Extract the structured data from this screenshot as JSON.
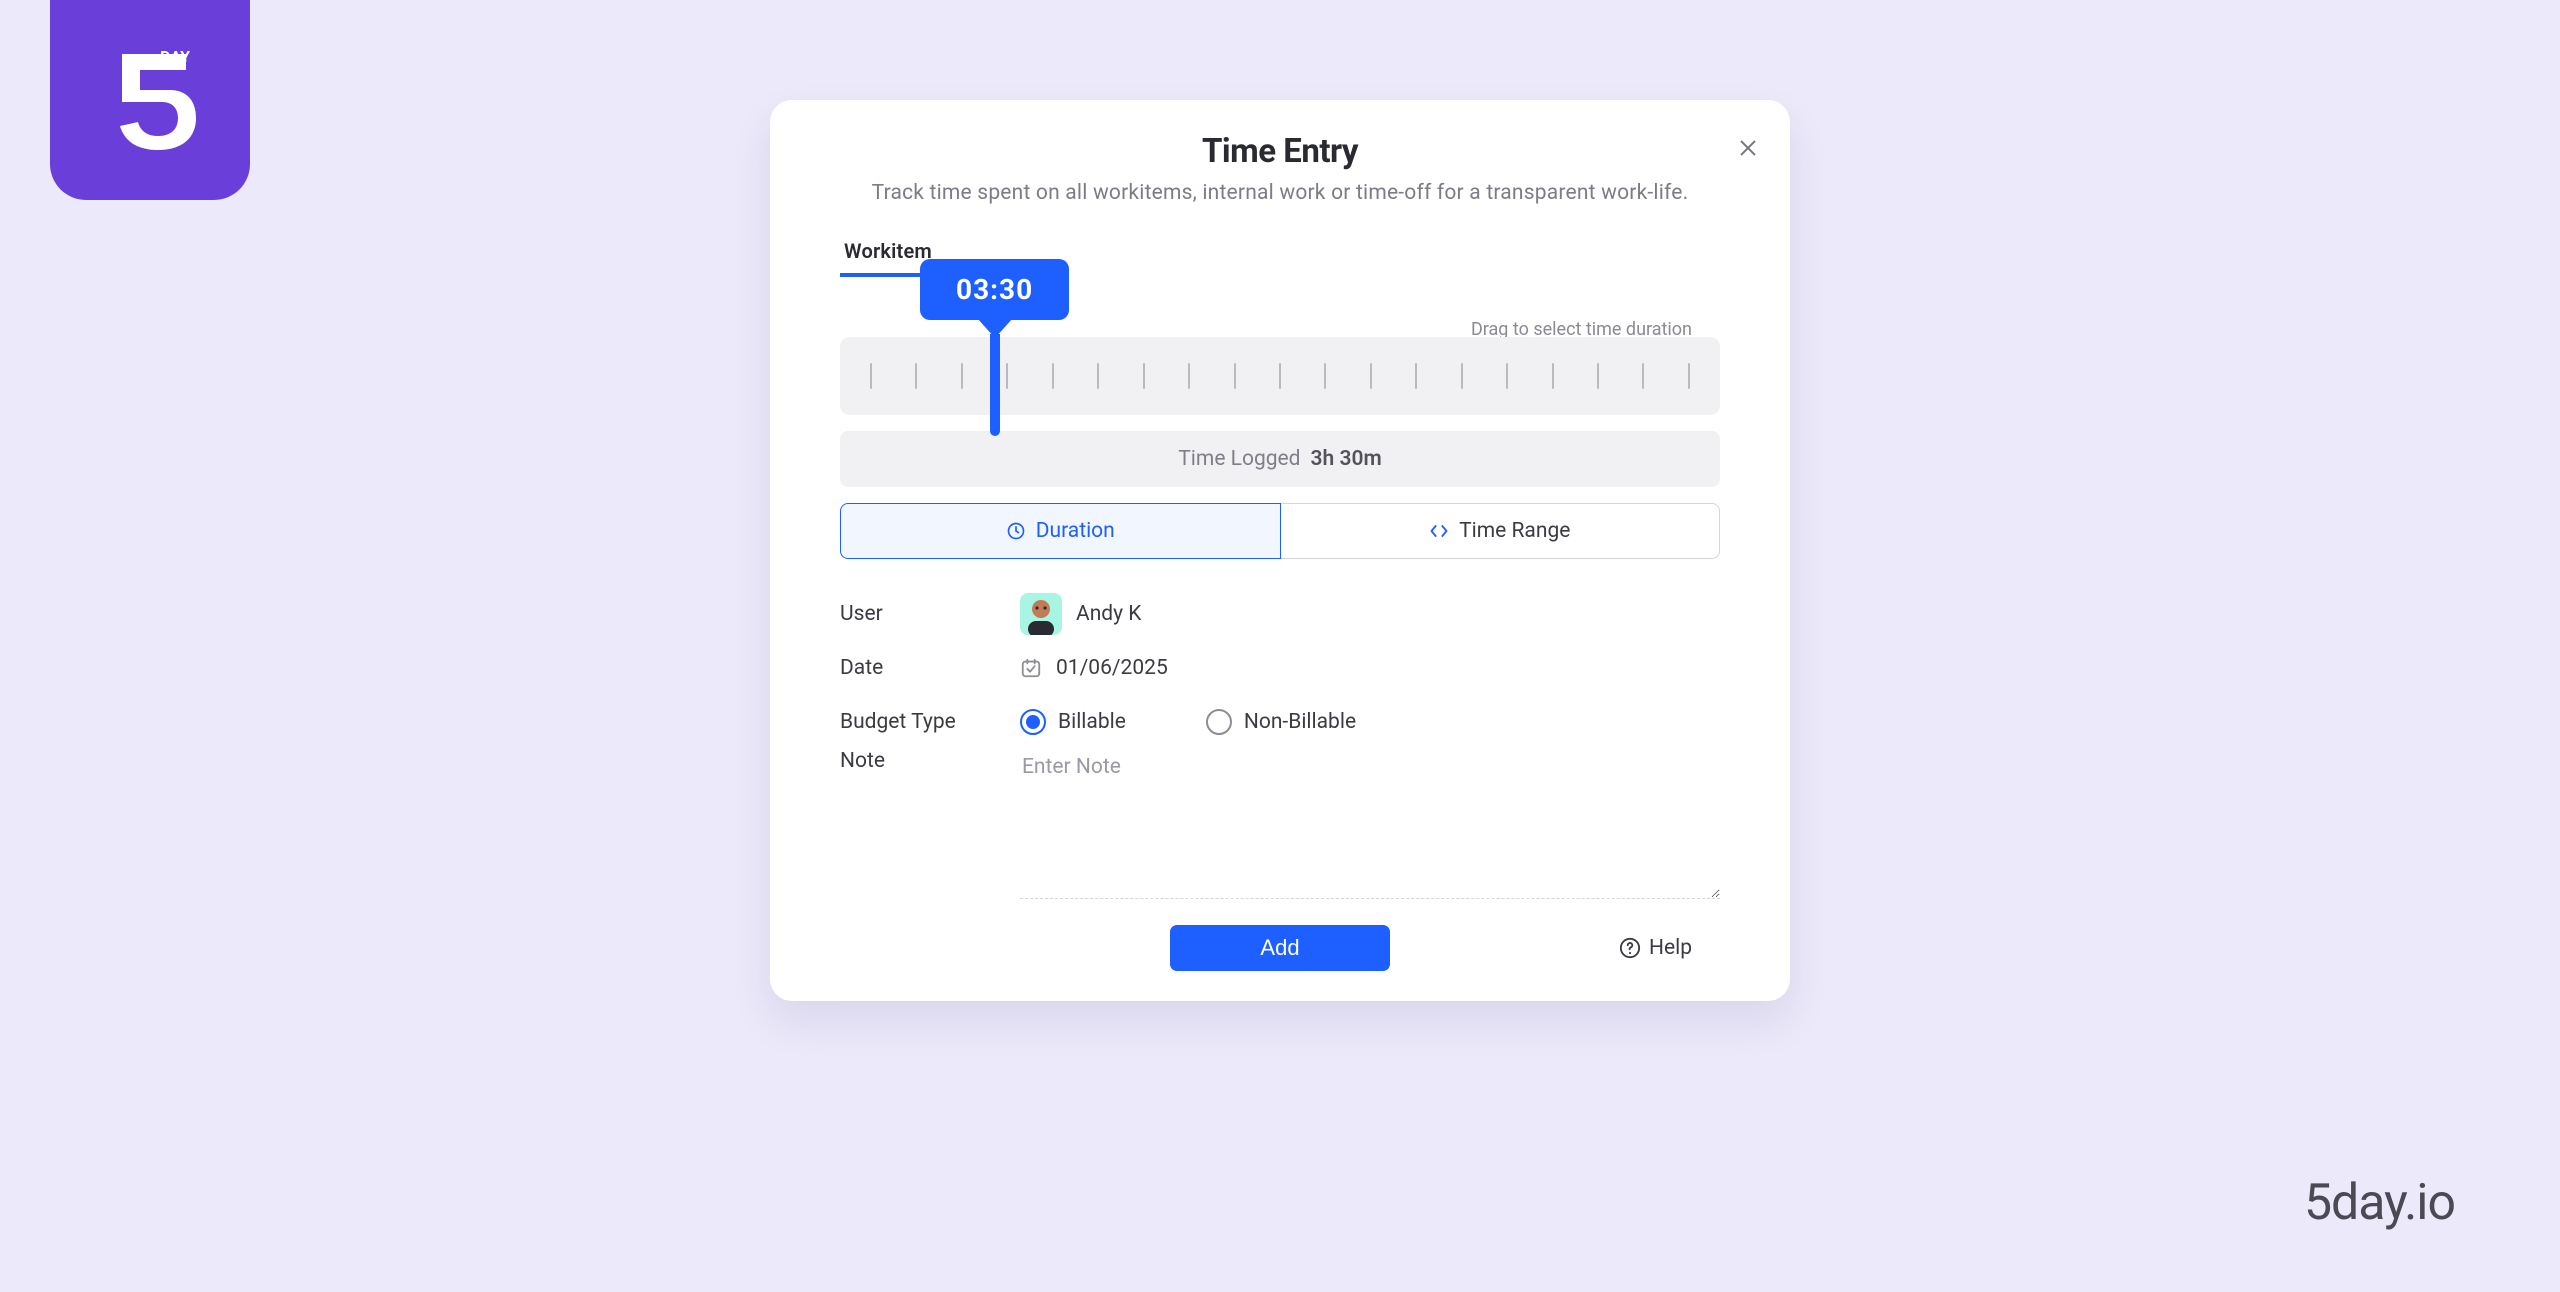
{
  "brand": {
    "name": "5day.io",
    "logo_text": "DAY"
  },
  "modal": {
    "title": "Time Entry",
    "subtitle": "Track time spent on all workitems, internal work or time-off for a transparent work-life.",
    "close_icon": "close-icon",
    "tabs": [
      {
        "label": "Workitem",
        "active": true
      }
    ],
    "slider": {
      "value_display": "03:30",
      "hint": "Drag to select time duration",
      "tick_count": 19
    },
    "time_logged": {
      "label": "Time Logged",
      "value": "3h 30m"
    },
    "mode_toggle": {
      "duration_label": "Duration",
      "time_range_label": "Time Range",
      "active": "duration"
    },
    "fields": {
      "user": {
        "label": "User",
        "name": "Andy K"
      },
      "date": {
        "label": "Date",
        "value": "01/06/2025"
      },
      "budget": {
        "label": "Budget Type",
        "options": {
          "billable": "Billable",
          "non_billable": "Non-Billable"
        },
        "selected": "billable"
      },
      "note": {
        "label": "Note",
        "placeholder": "Enter Note"
      }
    },
    "footer": {
      "add_label": "Add",
      "help_label": "Help"
    }
  }
}
